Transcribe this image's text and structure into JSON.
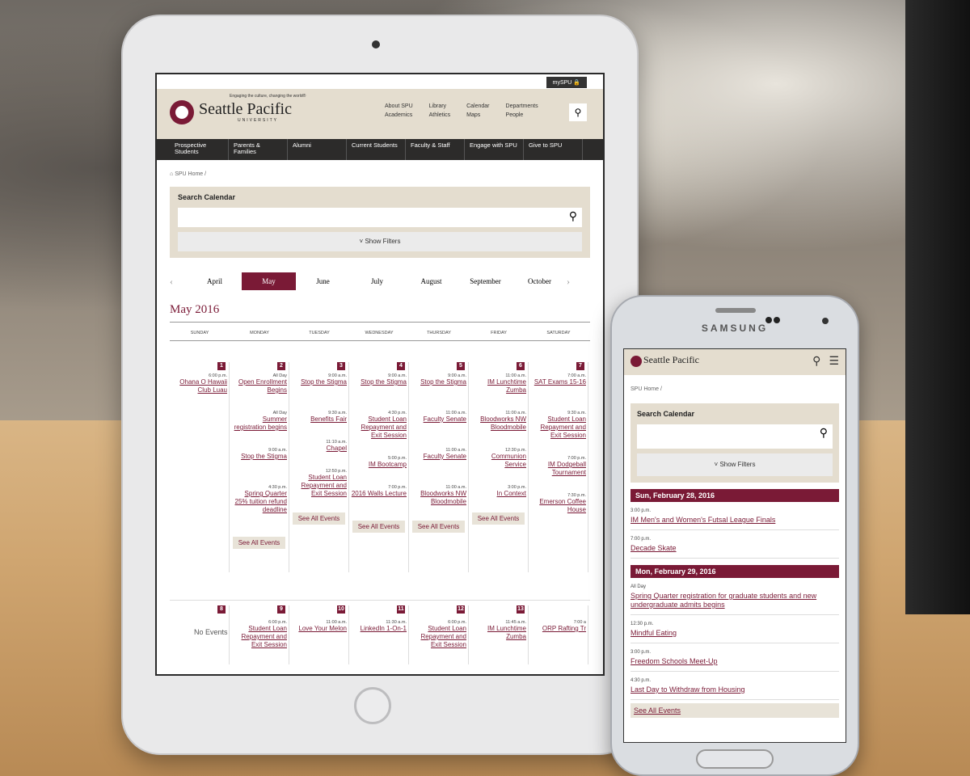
{
  "site": {
    "name": "Seattle Pacific",
    "university": "UNIVERSITY",
    "tagline": "Engaging the culture, changing the world®",
    "myspu": "mySPU 🔒"
  },
  "header_links": [
    [
      "About SPU",
      "Academics"
    ],
    [
      "Library",
      "Athletics"
    ],
    [
      "Calendar",
      "Maps"
    ],
    [
      "Departments",
      "People"
    ]
  ],
  "nav": [
    "Prospective Students",
    "Parents & Families",
    "Alumni",
    "Current Students",
    "Faculty & Staff",
    "Engage with SPU",
    "Give to SPU"
  ],
  "breadcrumb": "SPU Home /",
  "search": {
    "label": "Search Calendar",
    "filters": "˅ Show Filters"
  },
  "months": [
    "April",
    "May",
    "June",
    "July",
    "August",
    "September",
    "October"
  ],
  "active_month": "May",
  "month_title": "May 2016",
  "daynames": [
    "SUNDAY",
    "MONDAY",
    "TUESDAY",
    "WEDNESDAY",
    "THURSDAY",
    "FRIDAY",
    "SATURDAY"
  ],
  "week1": [
    {
      "day": "1",
      "events": [
        {
          "time": "6:00 p.m.",
          "name": "Ohana O Hawaii Club Luau"
        }
      ],
      "see_all": ""
    },
    {
      "day": "2",
      "events": [
        {
          "time": "All Day",
          "name": "Open Enrollment Begins"
        },
        {
          "time": "All Day",
          "name": "Summer registration begins"
        },
        {
          "time": "9:00 a.m.",
          "name": "Stop the Stigma"
        },
        {
          "time": "4:30 p.m.",
          "name": "Spring Quarter 25% tuition refund deadline"
        }
      ],
      "see_all": "See All Events"
    },
    {
      "day": "3",
      "events": [
        {
          "time": "9:00 a.m.",
          "name": "Stop the Stigma"
        },
        {
          "time": "9:30 a.m.",
          "name": "Benefits Fair"
        },
        {
          "time": "11:10 a.m.",
          "name": "Chapel"
        },
        {
          "time": "12:50 p.m.",
          "name": "Student Loan Repayment and Exit Session"
        }
      ],
      "see_all": "See All Events"
    },
    {
      "day": "4",
      "events": [
        {
          "time": "9:00 a.m.",
          "name": "Stop the Stigma"
        },
        {
          "time": "4:30 p.m.",
          "name": "Student Loan Repayment and Exit Session"
        },
        {
          "time": "5:00 p.m.",
          "name": "IM Bootcamp"
        },
        {
          "time": "7:00 p.m.",
          "name": "2016 Walls Lecture"
        }
      ],
      "see_all": "See All Events"
    },
    {
      "day": "5",
      "events": [
        {
          "time": "9:00 a.m.",
          "name": "Stop the Stigma"
        },
        {
          "time": "11:00 a.m.",
          "name": "Faculty Senate"
        },
        {
          "time": "11:00 a.m.",
          "name": "Faculty Senate"
        },
        {
          "time": "11:00 a.m.",
          "name": "Bloodworks NW Bloodmobile"
        }
      ],
      "see_all": "See All Events"
    },
    {
      "day": "6",
      "events": [
        {
          "time": "11:00 a.m.",
          "name": "IM Lunchtime Zumba"
        },
        {
          "time": "11:00 a.m.",
          "name": "Bloodworks NW Bloodmobile"
        },
        {
          "time": "12:30 p.m.",
          "name": "Communion Service"
        },
        {
          "time": "3:00 p.m.",
          "name": "In Context"
        }
      ],
      "see_all": "See All Events"
    },
    {
      "day": "7",
      "events": [
        {
          "time": "7:00 a.m.",
          "name": "SAT Exams 15-16"
        },
        {
          "time": "9:30 a.m.",
          "name": "Student Loan Repayment and Exit Session"
        },
        {
          "time": "7:00 p.m.",
          "name": "IM Dodgeball Tournament"
        },
        {
          "time": "7:30 p.m.",
          "name": "Emerson Coffee House"
        }
      ],
      "see_all": ""
    }
  ],
  "week2": [
    {
      "day": "8",
      "time": "",
      "name": "",
      "noev": "No Events"
    },
    {
      "day": "9",
      "time": "6:00 p.m.",
      "name": "Student Loan Repayment and Exit Session",
      "noev": ""
    },
    {
      "day": "10",
      "time": "11:00 a.m.",
      "name": "Love Your Melon",
      "noev": ""
    },
    {
      "day": "11",
      "time": "11:30 a.m.",
      "name": "LinkedIn 1-On-1",
      "noev": ""
    },
    {
      "day": "12",
      "time": "6:00 p.m.",
      "name": "Student Loan Repayment and Exit Session",
      "noev": ""
    },
    {
      "day": "13",
      "time": "11:45 a.m.",
      "name": "IM Lunchtime Zumba",
      "noev": ""
    },
    {
      "day": "",
      "time": "7:00 a",
      "name": "ORP Rafting Tr",
      "noev": ""
    }
  ],
  "phone": {
    "brand": "SAMSUNG",
    "breadcrumb": "SPU Home /",
    "days": [
      {
        "label": "Sun, February 28, 2016",
        "events": [
          {
            "time": "3:00 p.m.",
            "name": "IM Men's and Women's Futsal League Finals"
          },
          {
            "time": "7:00 p.m.",
            "name": "Decade Skate"
          }
        ]
      },
      {
        "label": "Mon, February 29, 2016",
        "events": [
          {
            "time": "All Day",
            "name": "Spring Quarter registration for graduate students and new undergraduate admits begins"
          },
          {
            "time": "12:30 p.m.",
            "name": "Mindful Eating"
          },
          {
            "time": "3:00 p.m.",
            "name": "Freedom Schools Meet-Up"
          },
          {
            "time": "4:30 p.m.",
            "name": "Last Day to Withdraw from Housing"
          }
        ]
      }
    ],
    "see_all": "See All Events"
  }
}
